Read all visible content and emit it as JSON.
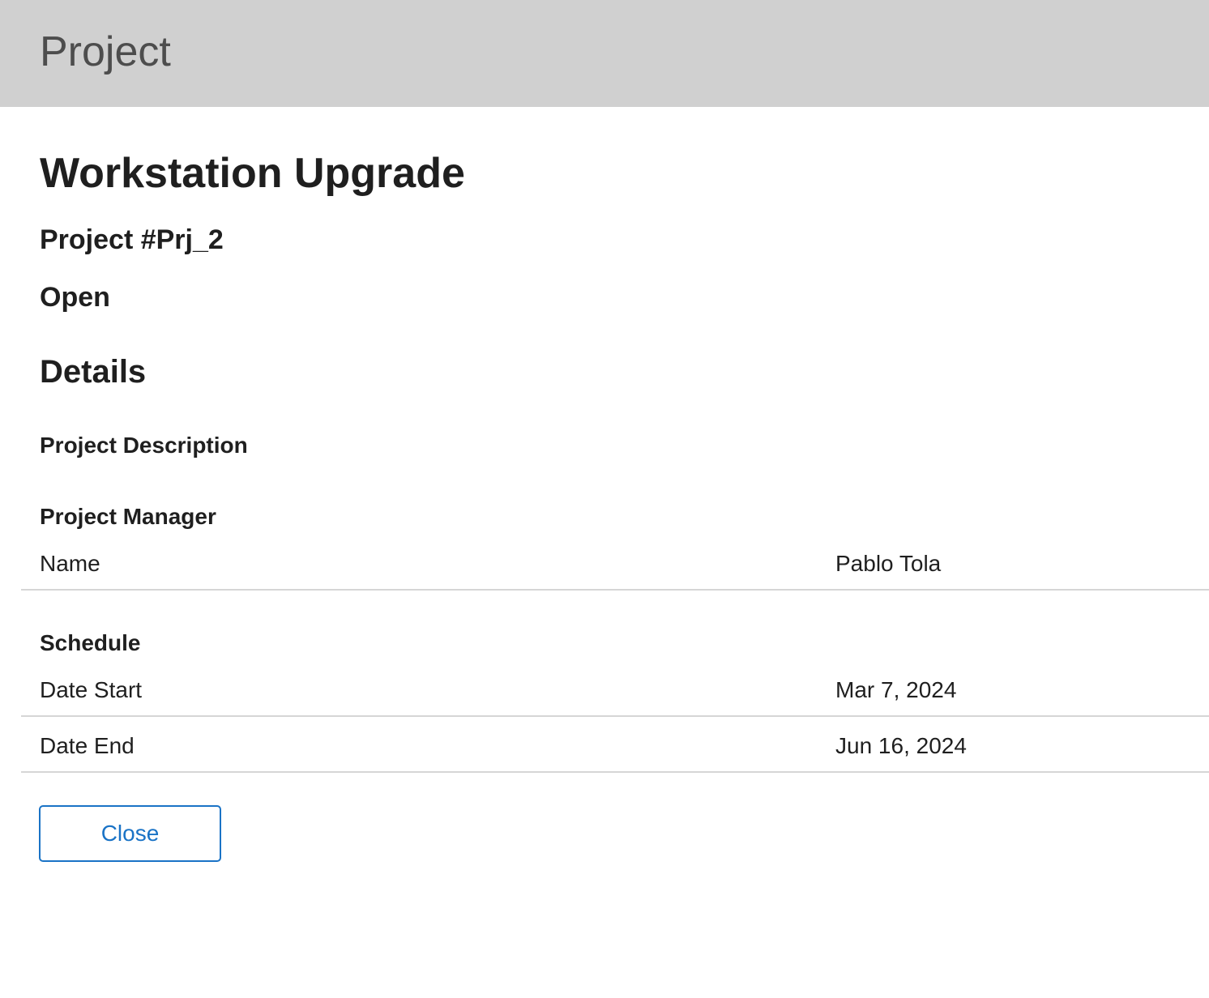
{
  "header": {
    "title": "Project"
  },
  "project": {
    "name": "Workstation Upgrade",
    "number": "Project #Prj_2",
    "status": "Open"
  },
  "details": {
    "heading": "Details",
    "description_label": "Project Description",
    "manager": {
      "label": "Project Manager",
      "name_label": "Name",
      "name_value": "Pablo Tola"
    },
    "schedule": {
      "label": "Schedule",
      "start_label": "Date Start",
      "start_value": "Mar 7, 2024",
      "end_label": "Date End",
      "end_value": "Jun 16, 2024"
    }
  },
  "actions": {
    "close_label": "Close"
  },
  "colors": {
    "header_bg": "#d0d0d0",
    "accent": "#1a73c6",
    "divider": "#d6d6d6"
  }
}
